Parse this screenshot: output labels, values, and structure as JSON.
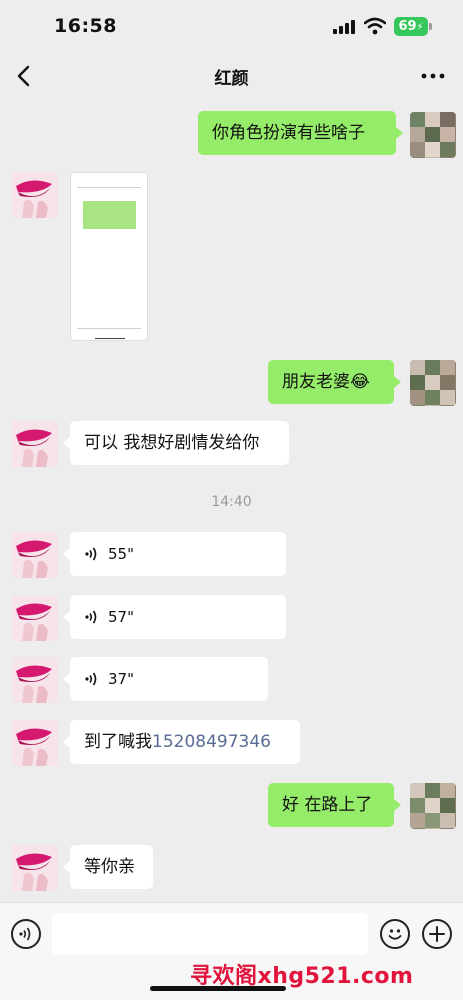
{
  "status_bar": {
    "time": "16:58",
    "battery": "69"
  },
  "nav": {
    "title": "红颜"
  },
  "messages": {
    "m1": "你角色扮演有些啥子",
    "m3": "朋友老婆",
    "m3_emoji": "😂",
    "m4": "可以 我想好剧情发给你",
    "divider_time": "14:40",
    "v1": "55\"",
    "v2": "57\"",
    "v3": "37\"",
    "m8_text": "到了喊我",
    "m8_phone": "15208497346",
    "m9": "好 在路上了",
    "m10": "等你亲"
  },
  "input": {
    "placeholder": ""
  },
  "watermark": "寻欢阁xhg521.com",
  "icons": {
    "back": "chevron-left-icon",
    "more": "ellipsis-icon",
    "voice": "voice-icon",
    "emoji": "smiley-icon",
    "plus": "plus-icon"
  },
  "colors": {
    "outgoing_bubble": "#95ec69",
    "incoming_bubble": "#ffffff",
    "background": "#ededed",
    "link": "#576b95"
  }
}
